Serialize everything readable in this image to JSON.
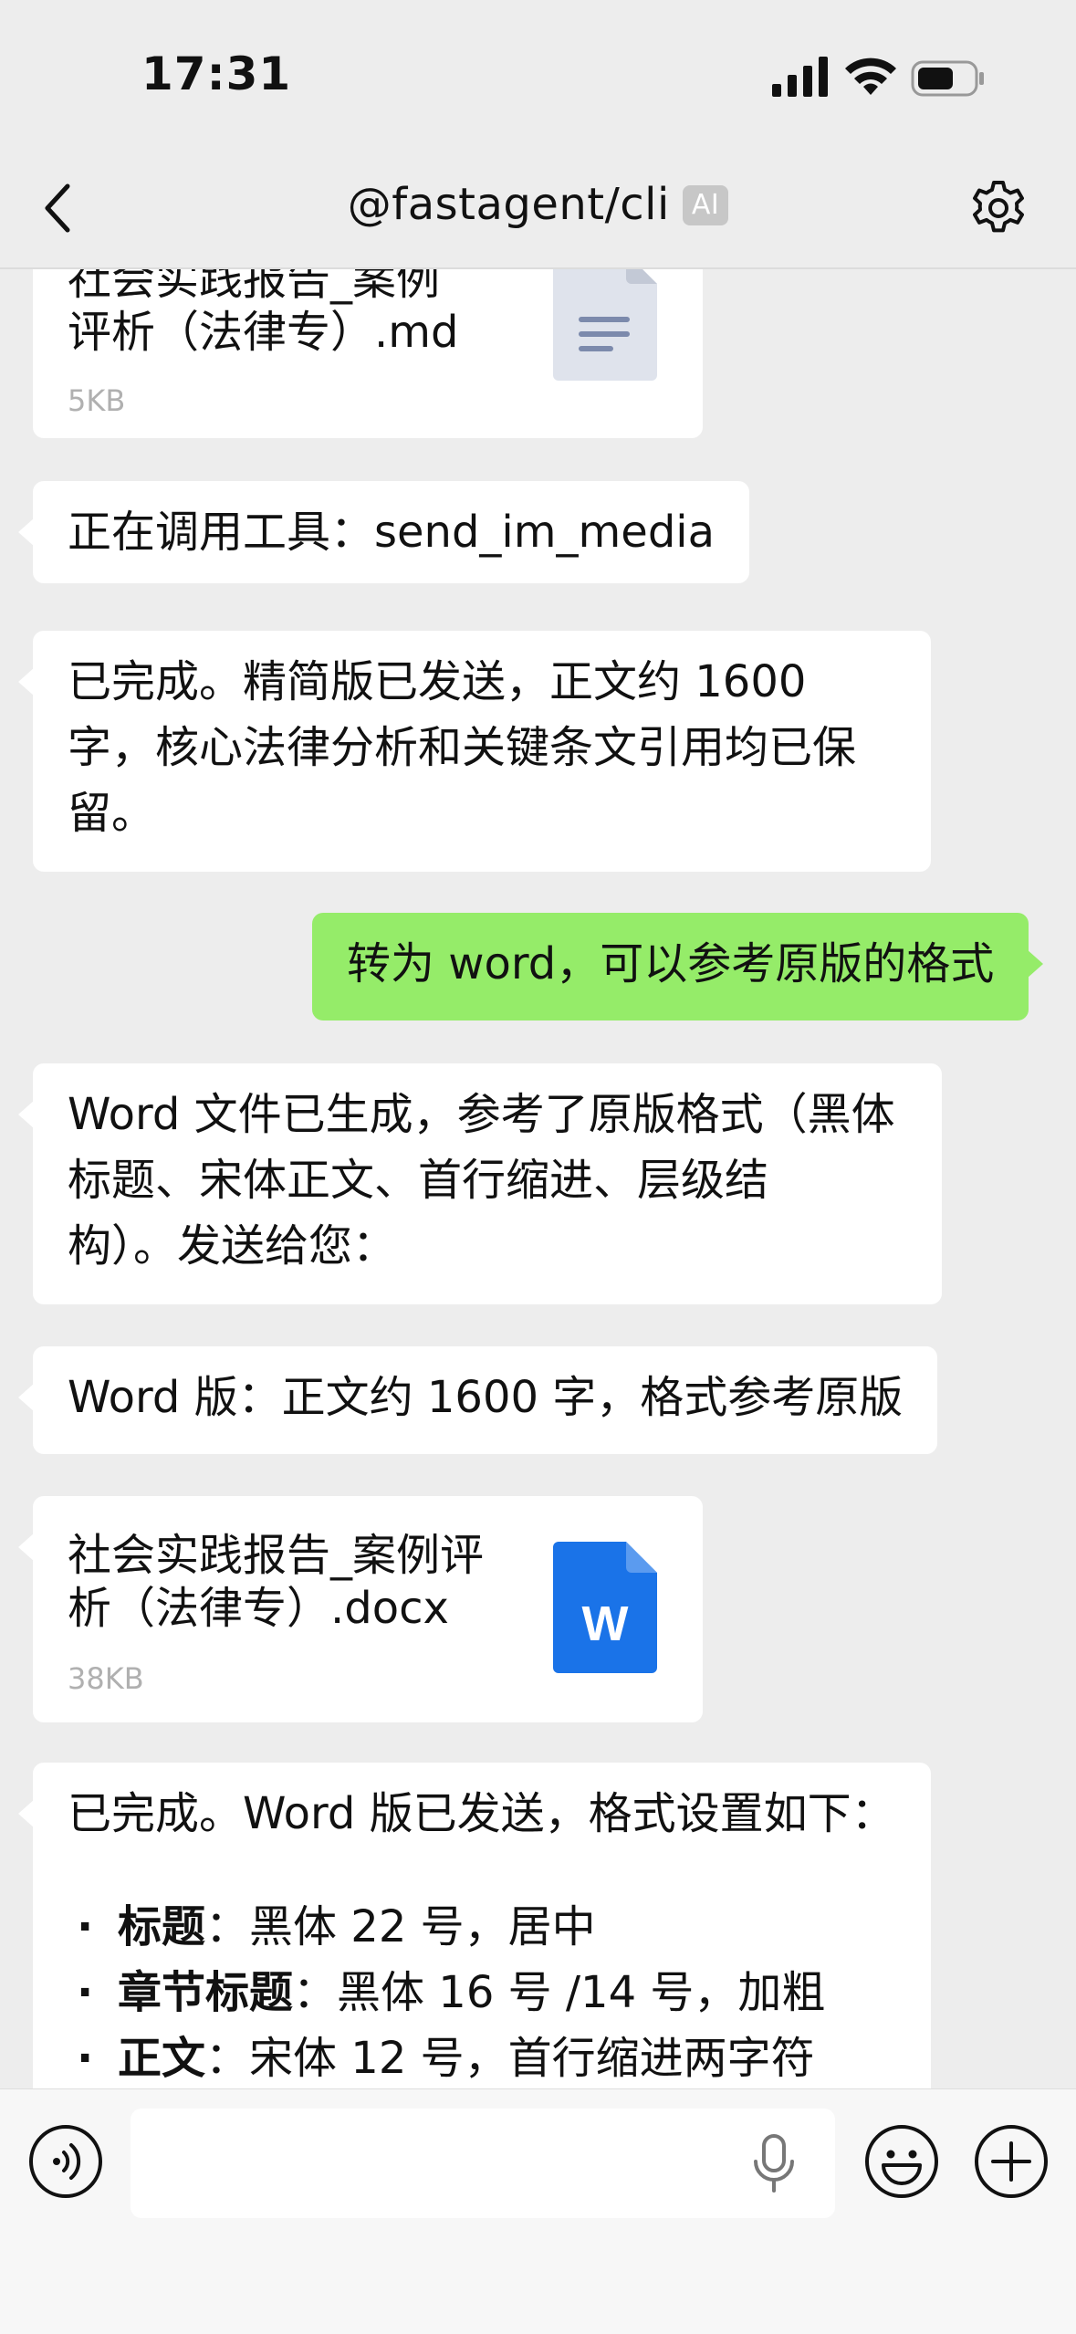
{
  "status_bar": {
    "time": "17:31"
  },
  "header": {
    "title": "@fastagent/cli",
    "badge": "AI"
  },
  "messages": {
    "file1": {
      "name_line1": "社会实践报告_案例",
      "name_line2": "评析（法律专）.md",
      "size": "5KB",
      "icon": "document-icon"
    },
    "tool_call": "正在调用工具：send_im_media",
    "done1": {
      "line1": "已完成。精简版已发送，正文约 1600",
      "line2": "字，核心法律分析和关键条文引用均已保",
      "line3": "留。"
    },
    "user1": "转为 word，可以参考原版的格式",
    "word_generated": {
      "line1": "Word 文件已生成，参考了原版格式（黑体",
      "line2": "标题、宋体正文、首行缩进、层级结",
      "line3": "构）。发送给您："
    },
    "word_caption": "Word 版：正文约 1600 字，格式参考原版",
    "file2": {
      "name_line1": "社会实践报告_案例评",
      "name_line2": "析（法律专）.docx",
      "size": "38KB",
      "icon_letter": "W",
      "icon_color": "#1a73e8"
    },
    "done2": {
      "intro": "已完成。Word 版已发送，格式设置如下：",
      "items": [
        {
          "label": "标题",
          "text": "：黑体 22 号，居中"
        },
        {
          "label": "章节标题",
          "text": "：黑体 16 号 /14 号，加粗"
        },
        {
          "label": "正文",
          "text": "：宋体 12 号，首行缩进两字符"
        }
      ]
    }
  },
  "colors": {
    "background": "#ededed",
    "outgoing_bubble": "#95ec69",
    "incoming_bubble": "#ffffff"
  }
}
